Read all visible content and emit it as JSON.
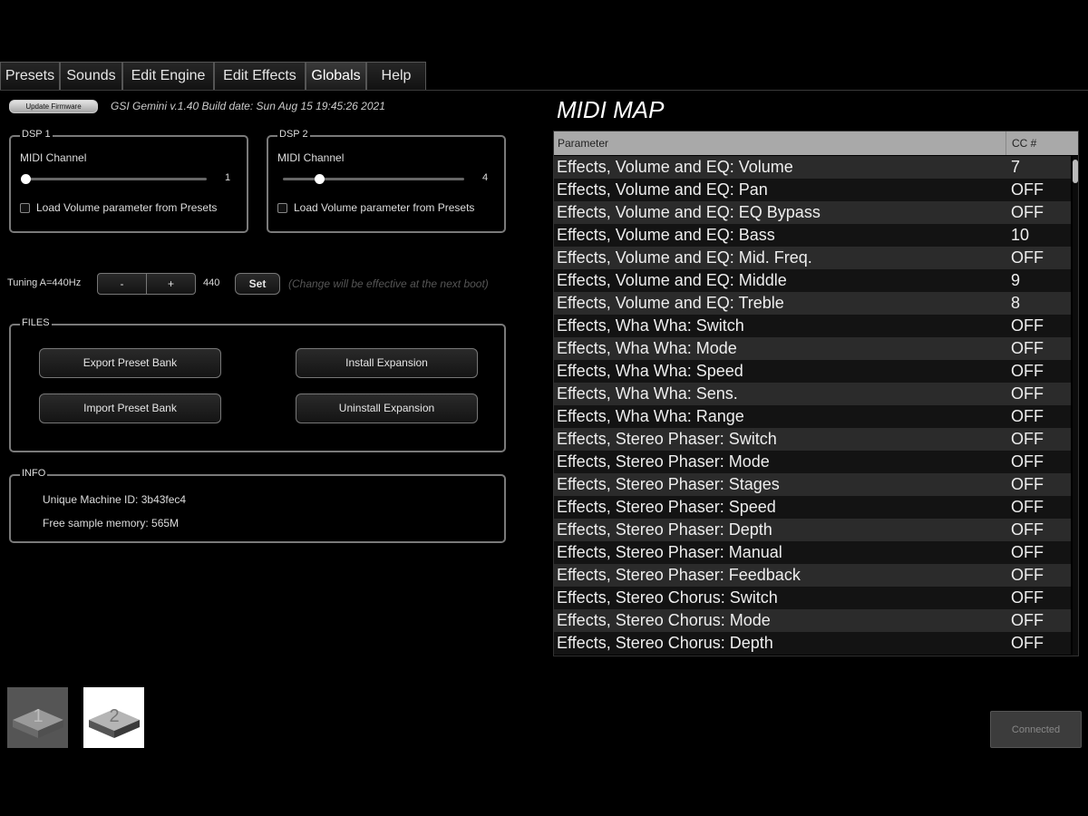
{
  "tabs": [
    "Presets",
    "Sounds",
    "Edit Engine",
    "Edit Effects",
    "Globals",
    "Help"
  ],
  "active_tab": "Globals",
  "update_button": "Update Firmware",
  "version_text": "GSI Gemini v.1.40 Build date: Sun Aug 15 19:45:26 2021",
  "dsp1": {
    "title": "DSP 1",
    "channel_label": "MIDI Channel",
    "channel_value": "1",
    "checkbox_label": "Load Volume parameter from Presets"
  },
  "dsp2": {
    "title": "DSP 2",
    "channel_label": "MIDI Channel",
    "channel_value": "4",
    "checkbox_label": "Load Volume parameter from Presets"
  },
  "tuning": {
    "label": "Tuning A=440Hz",
    "minus": "-",
    "plus": "+",
    "value": "440",
    "set": "Set",
    "hint": "(Change will be effective at the next boot)"
  },
  "files": {
    "title": "FILES",
    "export": "Export Preset Bank",
    "import": "Import Preset Bank",
    "install": "Install Expansion",
    "uninstall": "Uninstall Expansion"
  },
  "info": {
    "title": "INFO",
    "machine_id": "Unique Machine ID: 3b43fec4",
    "memory": "Free sample memory: 565M"
  },
  "midi_map": {
    "title": "MIDI MAP",
    "col_param": "Parameter",
    "col_cc": "CC #",
    "rows": [
      {
        "param": "Effects, Volume and EQ: Volume",
        "cc": "7"
      },
      {
        "param": "Effects, Volume and EQ: Pan",
        "cc": "OFF"
      },
      {
        "param": "Effects, Volume and EQ: EQ Bypass",
        "cc": "OFF"
      },
      {
        "param": "Effects, Volume and EQ: Bass",
        "cc": "10"
      },
      {
        "param": "Effects, Volume and EQ: Mid. Freq.",
        "cc": "OFF"
      },
      {
        "param": "Effects, Volume and EQ: Middle",
        "cc": "9"
      },
      {
        "param": "Effects, Volume and EQ: Treble",
        "cc": "8"
      },
      {
        "param": "Effects, Wha Wha: Switch",
        "cc": "OFF"
      },
      {
        "param": "Effects, Wha Wha: Mode",
        "cc": "OFF"
      },
      {
        "param": "Effects, Wha Wha: Speed",
        "cc": "OFF"
      },
      {
        "param": "Effects, Wha Wha: Sens.",
        "cc": "OFF"
      },
      {
        "param": "Effects, Wha Wha: Range",
        "cc": "OFF"
      },
      {
        "param": "Effects, Stereo Phaser: Switch",
        "cc": "OFF"
      },
      {
        "param": "Effects, Stereo Phaser: Mode",
        "cc": "OFF"
      },
      {
        "param": "Effects, Stereo Phaser: Stages",
        "cc": "OFF"
      },
      {
        "param": "Effects, Stereo Phaser: Speed",
        "cc": "OFF"
      },
      {
        "param": "Effects, Stereo Phaser: Depth",
        "cc": "OFF"
      },
      {
        "param": "Effects, Stereo Phaser: Manual",
        "cc": "OFF"
      },
      {
        "param": "Effects, Stereo Phaser: Feedback",
        "cc": "OFF"
      },
      {
        "param": "Effects, Stereo Chorus: Switch",
        "cc": "OFF"
      },
      {
        "param": "Effects, Stereo Chorus: Mode",
        "cc": "OFF"
      },
      {
        "param": "Effects, Stereo Chorus: Depth",
        "cc": "OFF"
      }
    ]
  },
  "dsp_selectors": {
    "one": "1",
    "two": "2"
  },
  "connected": "Connected",
  "colors": {
    "background": "#000000",
    "header_row": "#a9a9a9",
    "row_odd": "#2b2b2b",
    "row_even": "#131313"
  }
}
